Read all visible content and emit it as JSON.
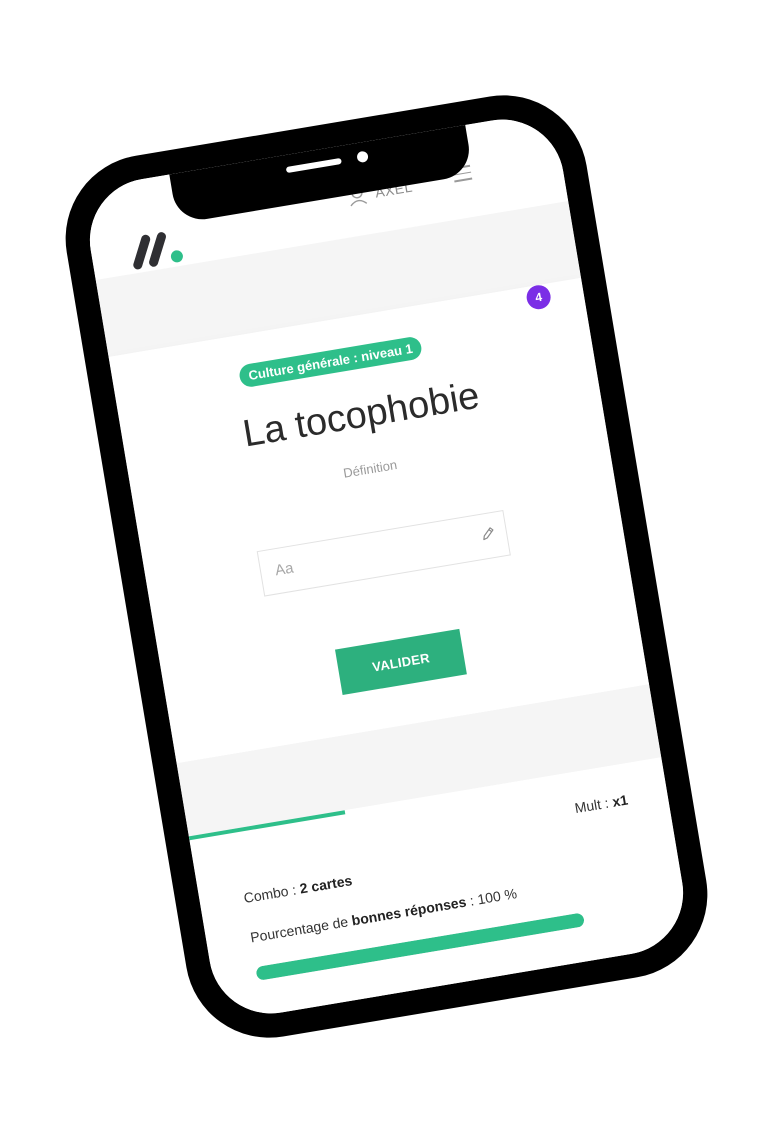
{
  "header": {
    "user_name": "AXEL",
    "icons": {
      "logo": "brand-logo",
      "user": "user-icon",
      "menu": "hamburger-menu-icon"
    }
  },
  "card": {
    "count_badge": "4",
    "category_tag": "Culture générale : niveau 1",
    "word": "La tocophobie",
    "subtitle": "Définition",
    "input": {
      "placeholder": "Aa",
      "value": "",
      "icon": "pencil-icon"
    },
    "validate_label": "VALIDER"
  },
  "stats": {
    "progress_fraction": 0.33,
    "mult_label": "Mult :",
    "mult_value": "x1",
    "combo_label": "Combo :",
    "combo_value": "2 cartes",
    "percent_prefix": "Pourcentage de",
    "percent_bold": "bonnes réponses",
    "percent_suffix": ": 100 %",
    "percent_value": 100
  },
  "colors": {
    "accent_green": "#2ebf8a",
    "button_green": "#2db07e",
    "badge_purple": "#7b2ee6",
    "frame_black": "#000000"
  }
}
